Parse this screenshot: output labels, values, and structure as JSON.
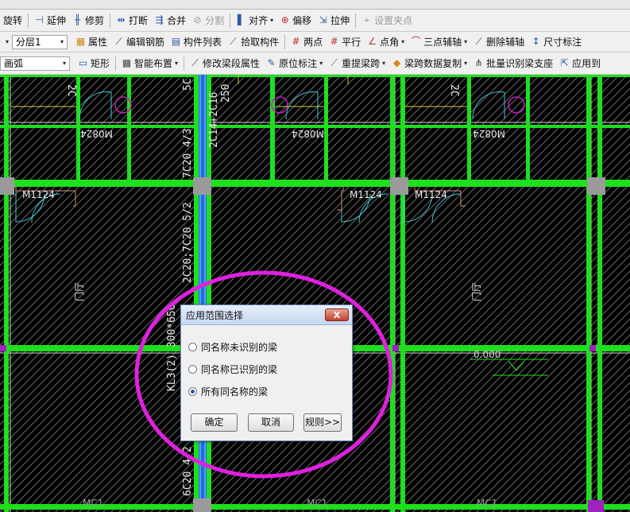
{
  "toolbar_row0": {
    "items": [
      "",
      "",
      "",
      "",
      "",
      ""
    ]
  },
  "toolbar_row1": {
    "items": [
      {
        "label": "旋转"
      },
      {
        "label": "延伸"
      },
      {
        "label": "修剪"
      },
      {
        "label": "打断"
      },
      {
        "label": "合并"
      },
      {
        "label": "分割",
        "disabled": true
      },
      {
        "label": "对齐"
      },
      {
        "label": "偏移"
      },
      {
        "label": "拉伸"
      },
      {
        "label": "设置夹点",
        "disabled": true
      }
    ]
  },
  "toolbar_row2": {
    "layer_combo": "分层1",
    "items": [
      {
        "label": "属性"
      },
      {
        "label": "编辑钢筋"
      },
      {
        "label": "构件列表"
      },
      {
        "label": "拾取构件"
      },
      {
        "label": "两点"
      },
      {
        "label": "平行"
      },
      {
        "label": "点角"
      },
      {
        "label": "三点辅轴"
      },
      {
        "label": "删除辅轴"
      },
      {
        "label": "尺寸标注"
      }
    ]
  },
  "toolbar_row3": {
    "arc_combo": "画弧",
    "items": [
      {
        "label": "矩形"
      },
      {
        "label": "智能布置"
      },
      {
        "label": "修改梁段属性"
      },
      {
        "label": "原位标注"
      },
      {
        "label": "重提梁跨"
      },
      {
        "label": "梁跨数据复制"
      },
      {
        "label": "批量识别梁支座"
      },
      {
        "label": "应用到"
      }
    ]
  },
  "canvas": {
    "labels": {
      "top_beam_a": "2C",
      "top_beam_b": "2C",
      "beam_5c": "5C",
      "beam_2c14": "2C14+2C16",
      "beam_250": "250",
      "beam_7c20": "7C20 4/3",
      "beam_2c20": "2C20;7C20 5/2",
      "beam_kl3": "KL3(2) 300*650",
      "beam_6c20": "6C20 4/2",
      "door_m0824_a": "M0824",
      "door_m0824_b": "M0824",
      "door_m1124_a": "M1124",
      "door_m1124_b": "M1124",
      "room_a": "门厅",
      "room_b": "门厅",
      "level_mark": "0.000",
      "mc1_a": "MC1",
      "mc1_b": "MC1",
      "mc1_c": "MC1"
    }
  },
  "dialog": {
    "title": "应用范围选择",
    "close_label": "X",
    "options": [
      {
        "label": "同名称未识别的梁",
        "checked": false
      },
      {
        "label": "同名称已识别的梁",
        "checked": false
      },
      {
        "label": "所有同名称的梁",
        "checked": true
      }
    ],
    "ok_label": "确定",
    "cancel_label": "取消",
    "rules_label": "规则>>"
  },
  "colors": {
    "canvas_bg": "#000000",
    "beam_green": "#1ee01e",
    "selected_beam": "#1e6ee0",
    "highlight_circle": "#e020e0",
    "wall_white": "#d8d8d8",
    "column_gray": "#9a9a9a"
  }
}
